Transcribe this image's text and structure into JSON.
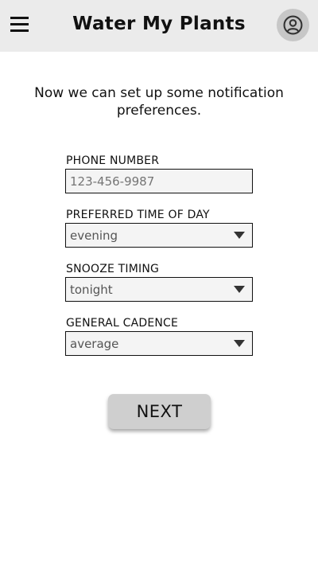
{
  "header": {
    "title": "Water My Plants",
    "menu_icon": "hamburger-menu-icon",
    "profile_icon": "user-circle-icon",
    "background_color": "#ebebeb"
  },
  "intro": {
    "text": "Now we can set up some notification preferences."
  },
  "form": {
    "phone": {
      "label": "PHONE NUMBER",
      "placeholder": "123-456-9987",
      "value": ""
    },
    "time_of_day": {
      "label": "PREFERRED TIME OF DAY",
      "value": "evening"
    },
    "snooze": {
      "label": "SNOOZE TIMING",
      "value": "tonight"
    },
    "cadence": {
      "label": "GENERAL CADENCE",
      "value": "average"
    }
  },
  "actions": {
    "next_label": "NEXT"
  }
}
